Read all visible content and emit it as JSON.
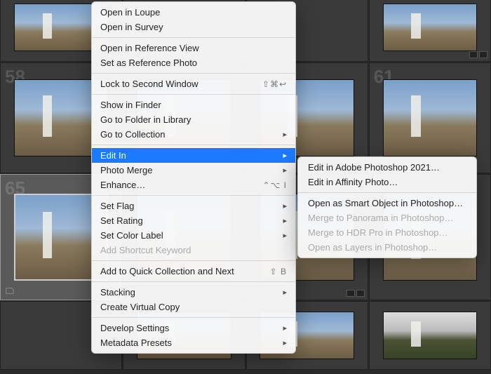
{
  "grid_numbers": [
    "58",
    "61",
    "65"
  ],
  "context_menu": {
    "groups": [
      [
        {
          "label": "Open in Loupe"
        },
        {
          "label": "Open in Survey"
        }
      ],
      [
        {
          "label": "Open in Reference View"
        },
        {
          "label": "Set as Reference Photo"
        }
      ],
      [
        {
          "label": "Lock to Second Window",
          "shortcut": "⇧⌘↩"
        }
      ],
      [
        {
          "label": "Show in Finder"
        },
        {
          "label": "Go to Folder in Library"
        },
        {
          "label": "Go to Collection",
          "submenu": true
        }
      ],
      [
        {
          "label": "Edit In",
          "submenu": true,
          "highlighted": true
        },
        {
          "label": "Photo Merge",
          "submenu": true
        },
        {
          "label": "Enhance…",
          "shortcut": "⌃⌥ I"
        }
      ],
      [
        {
          "label": "Set Flag",
          "submenu": true
        },
        {
          "label": "Set Rating",
          "submenu": true
        },
        {
          "label": "Set Color Label",
          "submenu": true
        },
        {
          "label": "Add Shortcut Keyword",
          "disabled": true
        }
      ],
      [
        {
          "label": "Add to Quick Collection and Next",
          "shortcut": "⇧ B"
        }
      ],
      [
        {
          "label": "Stacking",
          "submenu": true
        },
        {
          "label": "Create Virtual Copy"
        }
      ],
      [
        {
          "label": "Develop Settings",
          "submenu": true
        },
        {
          "label": "Metadata Presets",
          "submenu": true
        }
      ]
    ]
  },
  "submenu": {
    "groups": [
      [
        {
          "label": "Edit in Adobe Photoshop 2021…"
        },
        {
          "label": "Edit in Affinity Photo…"
        }
      ],
      [
        {
          "label": "Open as Smart Object in Photoshop…"
        },
        {
          "label": "Merge to Panorama in Photoshop…",
          "disabled": true
        },
        {
          "label": "Merge to HDR Pro in Photoshop…",
          "disabled": true
        },
        {
          "label": "Open as Layers in Photoshop…",
          "disabled": true
        }
      ]
    ]
  }
}
